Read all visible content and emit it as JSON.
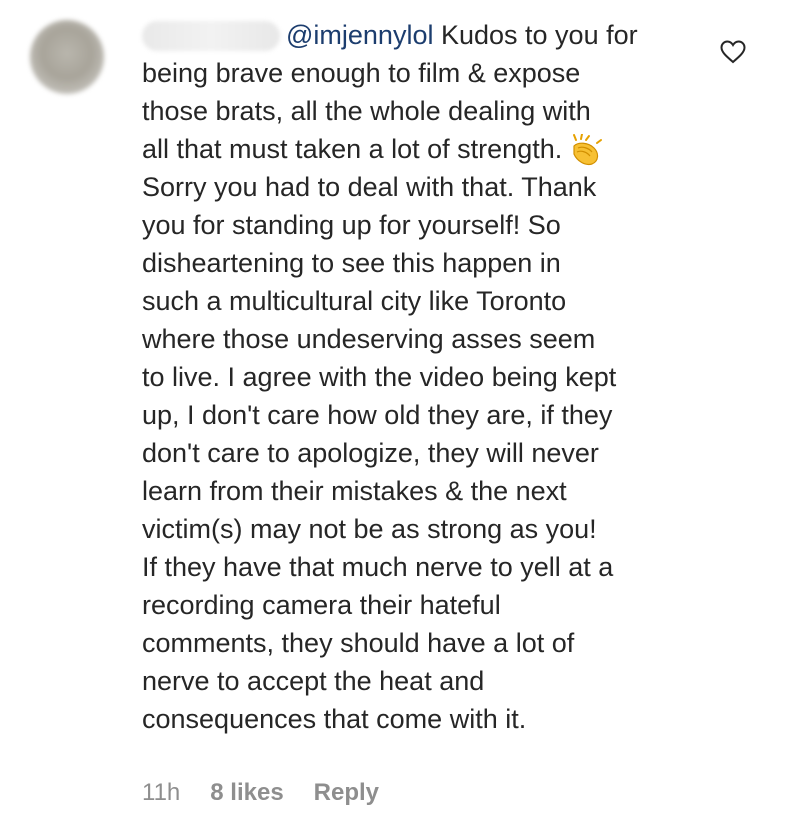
{
  "comment": {
    "mention": "@imjennylol",
    "lines": [
      " Kudos to you for",
      "being brave enough to film & expose",
      "those brats, all the whole dealing with",
      "all that must taken a lot of strength.",
      "Sorry you had to deal with that. Thank",
      "you for standing up for yourself! So",
      "disheartening to see this happen in",
      "such a multicultural city like Toronto",
      "where those undeserving asses seem",
      "to live. I agree with the video being kept",
      "up, I don't care how old they are, if they",
      "don't care to apologize, they will never",
      "learn from their mistakes & the next",
      "victim(s) may not be as strong as you!",
      "If they have that much nerve to yell at a",
      "recording camera their hateful",
      "comments, they should have a lot of",
      "nerve to accept the heat and",
      "consequences that come with it."
    ],
    "emoji": "clapping-hands",
    "time": "11h",
    "likes": "8 likes",
    "reply": "Reply"
  },
  "icons": {
    "like": "heart-outline-icon",
    "avatar": "blurred-avatar"
  },
  "colors": {
    "text": "#262626",
    "mention": "#1c3d6e",
    "meta": "#8e8e8e"
  }
}
